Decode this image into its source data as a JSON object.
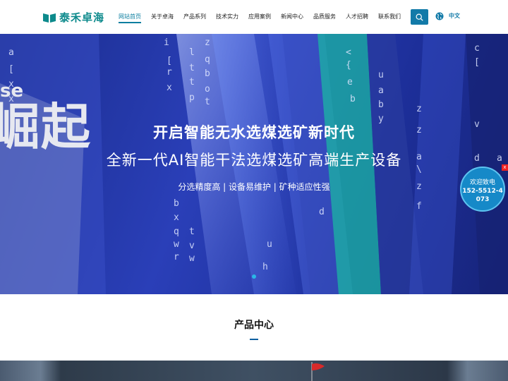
{
  "brand": {
    "name": "泰禾卓海",
    "color": "#0d8a8c"
  },
  "nav": {
    "items": [
      {
        "label": "网站首页",
        "active": true
      },
      {
        "label": "关于卓海",
        "active": false
      },
      {
        "label": "产品系列",
        "active": false
      },
      {
        "label": "技术实力",
        "active": false
      },
      {
        "label": "应用案例",
        "active": false
      },
      {
        "label": "新闻中心",
        "active": false
      },
      {
        "label": "品质服务",
        "active": false
      },
      {
        "label": "人才招聘",
        "active": false
      },
      {
        "label": "联系我们",
        "active": false
      }
    ],
    "search_icon": "search-icon",
    "globe_icon": "globe-icon",
    "language": "中文"
  },
  "hero": {
    "title": "开启智能无水选煤选矿新时代",
    "subtitle": "全新一代AI智能干法选煤选矿高端生产设备",
    "tags": "分选精度高 | 设备易维护 | 矿种适应性强",
    "bg_big_text": "崛起",
    "bg_small_text": "se",
    "accent": "#2ab7e6"
  },
  "hotline": {
    "label": "欢迎致电",
    "phone": "152-5512-4073",
    "close": "x"
  },
  "products": {
    "title": "产品中心"
  }
}
